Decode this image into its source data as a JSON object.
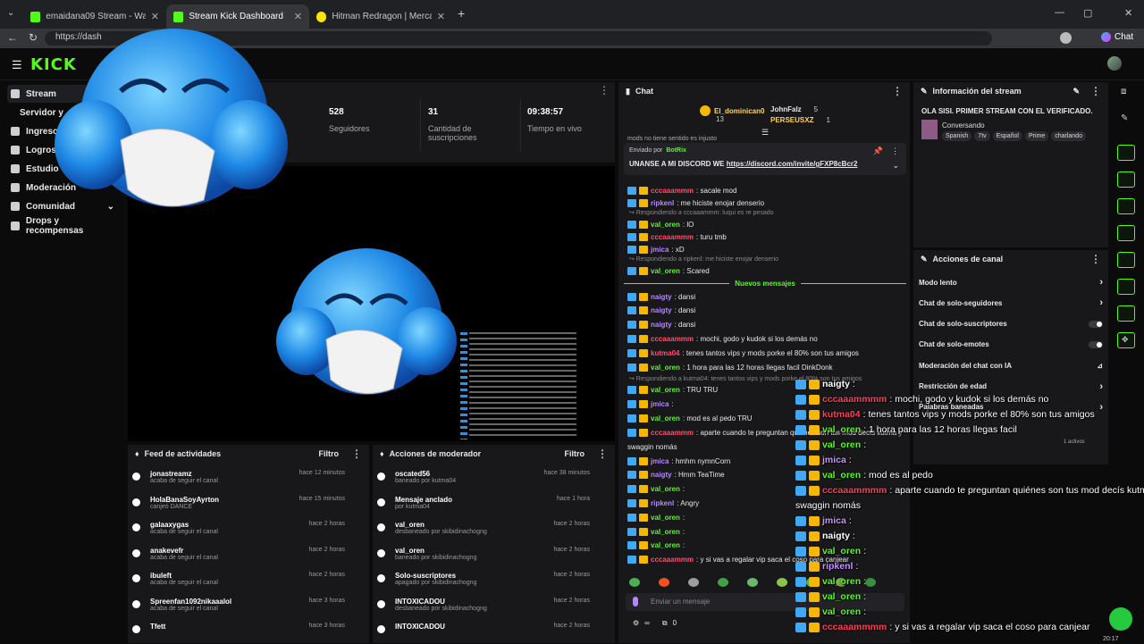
{
  "browser": {
    "tabs": [
      {
        "label": "emaidana09 Stream - Watch Live o",
        "active": false
      },
      {
        "label": "Stream Kick Dashboard",
        "active": true
      },
      {
        "label": "Hitman Redragon | MercadoLibre",
        "active": false
      }
    ],
    "url": "https://dash",
    "chat_button": "Chat"
  },
  "sidebar": {
    "items": [
      {
        "label": "Stream",
        "active": true
      },
      {
        "label": "Servidor y",
        "active": false
      },
      {
        "label": "Ingresos",
        "active": false
      },
      {
        "label": "Logros",
        "active": false
      },
      {
        "label": "Estudio",
        "active": false
      },
      {
        "label": "Moderación",
        "active": false
      },
      {
        "label": "Comunidad",
        "active": false
      },
      {
        "label": "Drops y recompensas",
        "active": false
      }
    ]
  },
  "stats": {
    "followers_value": "528",
    "followers_label": "Seguidores",
    "subs_value": "31",
    "subs_label": "Cantidad de suscripciones",
    "live_value": "09:38:57",
    "live_label": "Tiempo en vivo"
  },
  "activity": {
    "title": "Feed de actividades",
    "filter": "Filtro",
    "items": [
      {
        "name": "jonastreamz",
        "sub": "acaba de seguir el canal",
        "time": "hace 12 minutos"
      },
      {
        "name": "HolaBanaSoyAyrton",
        "sub": "canjeó DANCE",
        "time": "hace 15 minutos"
      },
      {
        "name": "galaaxygas",
        "sub": "acaba de seguir el canal",
        "time": "hace 2 horas"
      },
      {
        "name": "anakevefr",
        "sub": "acaba de seguir el canal",
        "time": "hace 2 horas"
      },
      {
        "name": "ibuleft",
        "sub": "acaba de seguir el canal",
        "time": "hace 2 horas"
      },
      {
        "name": "Spreenfan1092nikaaalol",
        "sub": "acaba de seguir el canal",
        "time": "hace 3 horas"
      },
      {
        "name": "Tfett",
        "sub": "",
        "time": "hace 3 horas"
      }
    ]
  },
  "modactions": {
    "title": "Acciones de moderador",
    "filter": "Filtro",
    "items": [
      {
        "name": "oscated56",
        "sub": "baneado por kutma04",
        "time": "hace 38 minutos"
      },
      {
        "name": "Mensaje anclado",
        "sub": "por kutma04",
        "time": "hace 1 hora"
      },
      {
        "name": "val_oren",
        "sub": "desbaneado por skibidinachogng",
        "time": "hace 2 horas"
      },
      {
        "name": "val_oren",
        "sub": "baneado por skibidinachogng",
        "time": "hace 2 horas"
      },
      {
        "name": "Solo-suscriptores",
        "sub": "apagado por skibidinachogng",
        "time": "hace 2 horas"
      },
      {
        "name": "INTOXICADOU",
        "sub": "desbaneado por skibidinachogng",
        "time": "hace 2 horas"
      },
      {
        "name": "INTOXICADOU",
        "sub": "",
        "time": "hace 2 horas"
      }
    ]
  },
  "chat": {
    "title": "Chat",
    "top_users": [
      {
        "name": "El_dominican0",
        "count": "13"
      },
      {
        "name": "JohnFalz",
        "count": "5"
      },
      {
        "name": "PERSEUSXZ",
        "count": "1"
      }
    ],
    "partial_line": "mods no tiene sentido es injusto",
    "pinned_by": "Enviado por",
    "pinned_bot": "BotRix",
    "pinned_text": "UNANSE A MI DISCORD WE",
    "pinned_link": "https://discord.com/invite/gFXP8cBcr2",
    "new_messages": "Nuevos mensajes",
    "input_placeholder": "Enviar un mensaje",
    "counter": "0",
    "lines": [
      {
        "user": "cccaaammm",
        "text": ": sacale mod",
        "color": "#ff4d6d"
      },
      {
        "user": "ripkenl",
        "text": ": me hiciste enojar denserio",
        "color": "#b388ff"
      },
      {
        "reply": "Respondiendo a cccaaammm: luqui es re pesado"
      },
      {
        "user": "val_oren",
        "text": ": lO",
        "color": "#53fc18"
      },
      {
        "user": "cccaaammm",
        "text": ": turu tmb",
        "color": "#ff4d6d"
      },
      {
        "user": "jmica",
        "text": ": xD",
        "color": "#b388ff"
      },
      {
        "reply": "Respondiendo a ripkenl: me hiciste enojar denserio"
      },
      {
        "user": "val_oren",
        "text": ": Scared",
        "color": "#53fc18"
      },
      {
        "divider": true
      },
      {
        "user": "naigty",
        "text": ": dansi",
        "color": "#b388ff"
      },
      {
        "user": "naigty",
        "text": ": dansi",
        "color": "#b388ff"
      },
      {
        "user": "naigty",
        "text": ": dansi",
        "color": "#b388ff"
      },
      {
        "user": "cccaaammm",
        "text": ": mochi, godo y kudok si los demás no",
        "color": "#ff4d6d"
      },
      {
        "user": "kutma04",
        "text": ": tenes tantos vips y mods porke el 80% son tus amigos",
        "color": "#ff4d6d"
      },
      {
        "user": "val_oren",
        "text": ": 1 hora para las 12 horas llegas facil DinkDonk",
        "color": "#53fc18"
      },
      {
        "reply": "Respondiendo a kutma04: tenes tantos vips y mods porke el 80% son tus amigos"
      },
      {
        "user": "val_oren",
        "text": ": TRU TRU",
        "color": "#53fc18"
      },
      {
        "user": "jmica",
        "text": ":",
        "color": "#b388ff"
      },
      {
        "user": "val_oren",
        "text": ": mod es al pedo TRU",
        "color": "#53fc18"
      },
      {
        "user": "cccaaammm",
        "text": ": aparte cuando te preguntan quiénes son tus mod decís kutma y",
        "color": "#ff4d6d"
      },
      {
        "plain": "swaggin nomás"
      },
      {
        "user": "jmica",
        "text": ": hmhm nymnCorn",
        "color": "#b388ff"
      },
      {
        "user": "naigty",
        "text": ": Hmm TeaTime",
        "color": "#b388ff"
      },
      {
        "user": "val_oren",
        "text": ":",
        "color": "#53fc18"
      },
      {
        "user": "ripkenl",
        "text": ": Angry",
        "color": "#b388ff"
      },
      {
        "user": "val_oren",
        "text": ":",
        "color": "#53fc18"
      },
      {
        "user": "val_oren",
        "text": ":",
        "color": "#53fc18"
      },
      {
        "user": "val_oren",
        "text": ":",
        "color": "#53fc18"
      },
      {
        "user": "cccaaammm",
        "text": ": y si vas a regalar vip saca el coso para canjear",
        "color": "#ff4d6d"
      }
    ]
  },
  "streaminfo": {
    "title": "Información del stream",
    "stream_title": "OLA SISI. PRIMER STREAM CON EL VERIFICADO.",
    "category": "Conversando",
    "tags": [
      "Spanish",
      "7tv",
      "Español",
      "Prime",
      "charlando"
    ]
  },
  "channelactions": {
    "title": "Acciones de canal",
    "items": [
      {
        "label": "Modo lento",
        "control": "arrow"
      },
      {
        "label": "Chat de solo-seguidores",
        "control": "arrow"
      },
      {
        "label": "Chat de solo-suscriptores",
        "control": "toggle"
      },
      {
        "label": "Chat de solo-emotes",
        "control": "toggle"
      },
      {
        "label": "Moderación del chat con IA",
        "control": "icon"
      },
      {
        "label": "Restricción de edad",
        "control": "arrow"
      },
      {
        "label": "Palabras baneadas",
        "control": "arrow"
      }
    ],
    "actives": "1 activos"
  },
  "overlay": {
    "lines": [
      {
        "user": "naigty",
        "text": ":",
        "color": "#ffffff"
      },
      {
        "user": "cccaaammmm",
        "text": ": mochi, godo y kudok si los demás no",
        "color": "#ff3d5a"
      },
      {
        "user": "kutma04",
        "text": ": tenes tantos vips y mods porke el 80% son tus amigos",
        "color": "#ff3d5a"
      },
      {
        "user": "val_oren",
        "text": ": 1 hora para las 12 horas llegas facil",
        "color": "#53fc18"
      },
      {
        "user": "val_oren",
        "text": ":",
        "color": "#53fc18"
      },
      {
        "user": "jmica",
        "text": ":",
        "color": "#c792ff"
      },
      {
        "user": "val_oren",
        "text": ": mod es al pedo",
        "color": "#53fc18"
      },
      {
        "user": "cccaaammmm",
        "text": ": aparte cuando te preguntan quiénes son tus mod decís kutma y",
        "color": "#ff3d5a"
      },
      {
        "plain": "swaggin nomás"
      },
      {
        "user": "jmica",
        "text": ":",
        "color": "#c792ff"
      },
      {
        "user": "naigty",
        "text": ":",
        "color": "#ffffff"
      },
      {
        "user": "val_oren",
        "text": ":",
        "color": "#53fc18"
      },
      {
        "user": "ripkenl",
        "text": ":",
        "color": "#c792ff"
      },
      {
        "user": "val_oren",
        "text": ":",
        "color": "#53fc18"
      },
      {
        "user": "val_oren",
        "text": ":",
        "color": "#53fc18"
      },
      {
        "user": "val_oren",
        "text": ":",
        "color": "#53fc18"
      },
      {
        "user": "cccaaammmm",
        "text": ": y si vas a regalar vip saca el coso para canjear",
        "color": "#ff3d5a"
      }
    ]
  },
  "clock": "20:17",
  "colors": {
    "accent": "#53fc18",
    "panel": "#18181b",
    "bg": "#0b0b0c"
  }
}
